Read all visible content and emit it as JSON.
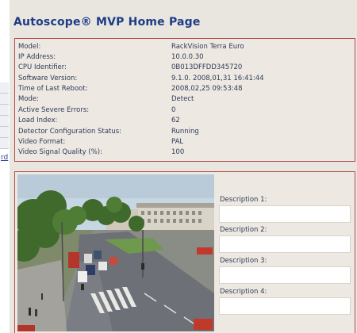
{
  "page": {
    "title": "Autoscope® MVP Home Page"
  },
  "side_nav": {
    "link_fragment": "rd"
  },
  "info": {
    "rows": [
      {
        "label": "Model:",
        "value": "RackVision Terra Euro"
      },
      {
        "label": "IP Address:",
        "value": "10.0.0.30"
      },
      {
        "label": "CPU Identifier:",
        "value": "0B013DFFDD345720"
      },
      {
        "label": "Software Version:",
        "value": "9.1.0. 2008,01,31 16:41:44"
      },
      {
        "label": "Time of Last Reboot:",
        "value": "2008,02,25 09:53:48"
      },
      {
        "label": "Mode:",
        "value": "Detect"
      },
      {
        "label": "Active Severe Errors:",
        "value": "0"
      },
      {
        "label": "Load Index:",
        "value": "62"
      },
      {
        "label": "Detector Configuration Status:",
        "value": "Running"
      },
      {
        "label": "Video Format:",
        "value": "PAL"
      },
      {
        "label": "Video Signal Quality (%):",
        "value": "100"
      }
    ]
  },
  "video": {
    "descriptions": [
      {
        "label": "Description 1:",
        "value": ""
      },
      {
        "label": "Description 2:",
        "value": ""
      },
      {
        "label": "Description 3:",
        "value": ""
      },
      {
        "label": "Description 4:",
        "value": ""
      }
    ]
  },
  "colors": {
    "title": "#1d3b86",
    "panel_border": "#b54b4b",
    "panel_bg": "#ede9e2",
    "page_bg": "#e8e6df",
    "text": "#2f3a55"
  }
}
